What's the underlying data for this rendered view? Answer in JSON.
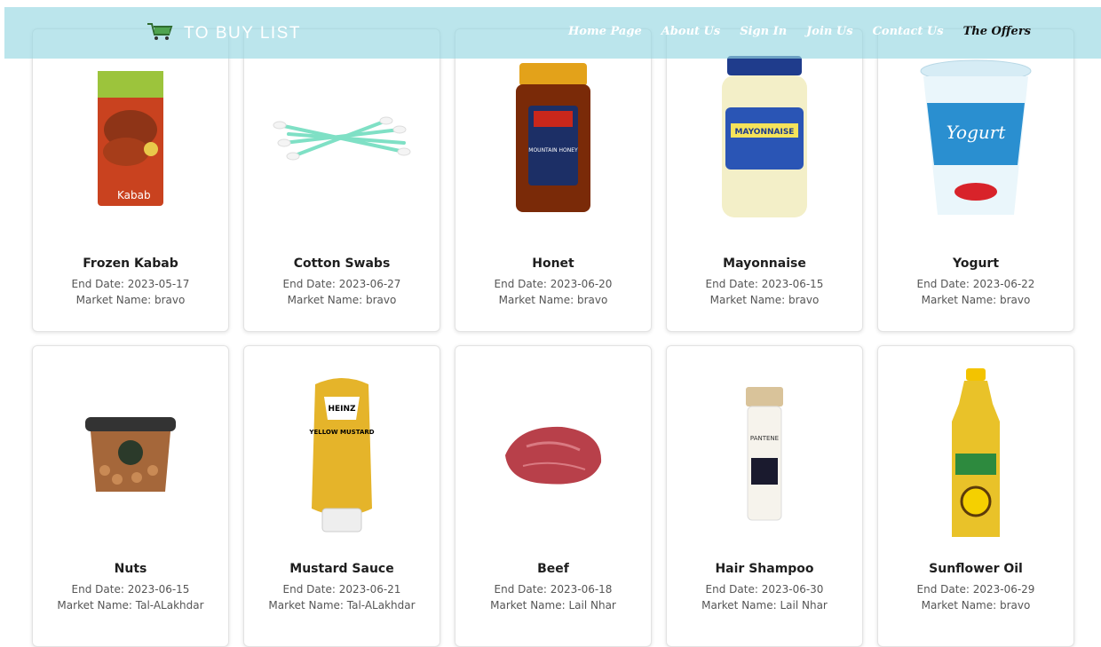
{
  "brand": {
    "title": "TO BUY LIST",
    "icon": "shopping-cart-icon"
  },
  "nav": {
    "items": [
      {
        "label": "Home Page"
      },
      {
        "label": "About Us"
      },
      {
        "label": "Sign In"
      },
      {
        "label": "Join Us"
      },
      {
        "label": "Contact Us"
      },
      {
        "label": "The Offers"
      }
    ]
  },
  "products": [
    {
      "name": "Frozen Kabab",
      "end_date": "End Date: 2023-05-17",
      "market": "Market Name: bravo",
      "icon": "kabab-package-image"
    },
    {
      "name": "Cotton Swabs",
      "end_date": "End Date: 2023-06-27",
      "market": "Market Name: bravo",
      "icon": "cotton-swabs-image"
    },
    {
      "name": "Honet",
      "end_date": "End Date: 2023-06-20",
      "market": "Market Name: bravo",
      "icon": "honey-jar-image"
    },
    {
      "name": "Mayonnaise",
      "end_date": "End Date: 2023-06-15",
      "market": "Market Name: bravo",
      "icon": "mayonnaise-jar-image"
    },
    {
      "name": "Yogurt",
      "end_date": "End Date: 2023-06-22",
      "market": "Market Name: bravo",
      "icon": "yogurt-cup-image"
    },
    {
      "name": "Nuts",
      "end_date": "End Date: 2023-06-15",
      "market": "Market Name: Tal-ALakhdar",
      "icon": "nuts-tub-image"
    },
    {
      "name": "Mustard Sauce",
      "end_date": "End Date: 2023-06-21",
      "market": "Market Name: Tal-ALakhdar",
      "icon": "mustard-bottle-image"
    },
    {
      "name": "Beef",
      "end_date": "End Date: 2023-06-18",
      "market": "Market Name: Lail Nhar",
      "icon": "beef-image"
    },
    {
      "name": "Hair Shampoo",
      "end_date": "End Date: 2023-06-30",
      "market": "Market Name: Lail Nhar",
      "icon": "shampoo-bottle-image"
    },
    {
      "name": "Sunflower Oil",
      "end_date": "End Date: 2023-06-29",
      "market": "Market Name: bravo",
      "icon": "oil-bottle-image"
    }
  ],
  "image_labels": {
    "kabab": "Kabab",
    "honey": "MOUNTAIN HONEY",
    "mayo": "MAYONNAISE",
    "yogurt": "Yogurt",
    "mustard_brand": "HEINZ",
    "mustard_label": "YELLOW MUSTARD",
    "shampoo": "PANTENE"
  },
  "colors": {
    "navbar": "#96d7e2",
    "active_nav": "#111111",
    "nav_text": "#ffffff"
  }
}
